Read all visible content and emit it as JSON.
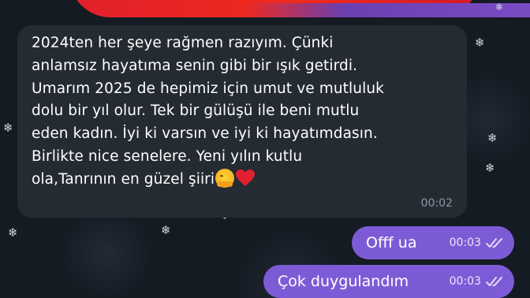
{
  "incoming_message": {
    "lines": [
      "2024ten her şeye rağmen razıyım. Çünki",
      "anlamsız hayatıma senin gibi bir ışık getirdi.",
      "Umarım 2025 de hepimiz için umut ve mutluluk",
      "dolu bir yıl olur. Tek bir gülüşü ile beni mutlu",
      "eden kadın. İyi ki varsın ve iyi ki hayatımdasın.",
      "Birlikte nice senelere. Yeni yılın kutlu",
      "ola,Tanrının en güzel şiiri"
    ],
    "time": "00:02",
    "emojis": [
      "hugging-face",
      "red-heart"
    ]
  },
  "outgoing_messages": [
    {
      "text": "Offf ua",
      "time": "00:03",
      "status": "read"
    },
    {
      "text": "Çok duygulandım",
      "time": "00:03",
      "status": "read"
    }
  ],
  "colors": {
    "background": "#151b23",
    "incoming_bubble": "#252b33",
    "outgoing_bubble": "#7e5bd6",
    "top_decoration_red": "#e0202b",
    "top_decoration_purple": "#7a4cc4"
  }
}
